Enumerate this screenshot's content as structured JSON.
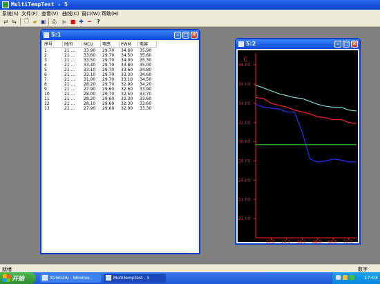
{
  "app": {
    "title": "MultiTempTest - 5"
  },
  "menu": [
    "系统(S)",
    "文件(F)",
    "查看(V)",
    "曲线(C)",
    "窗口(W)",
    "帮助(H)"
  ],
  "toolbar": {
    "icons": [
      "connect-icon",
      "disconnect-icon",
      "new-file-icon",
      "open-folder-icon",
      "save-icon",
      "print-icon",
      "play-icon",
      "stop-icon",
      "add-icon",
      "remove-icon",
      "help-icon"
    ]
  },
  "table_window": {
    "title": "5:1",
    "columns": [
      "序号",
      "时间",
      "MCU",
      "电感",
      "PWM",
      "电容"
    ],
    "rows": [
      [
        "1",
        "21 ...",
        "33.90",
        "29.70",
        "34.60",
        "35.90"
      ],
      [
        "2",
        "21 ...",
        "33.60",
        "29.70",
        "34.50",
        "35.60"
      ],
      [
        "3",
        "21 ...",
        "33.50",
        "29.70",
        "34.00",
        "35.30"
      ],
      [
        "4",
        "21 ...",
        "33.40",
        "29.70",
        "33.80",
        "35.00"
      ],
      [
        "5",
        "21 ...",
        "33.10",
        "29.70",
        "33.60",
        "34.80"
      ],
      [
        "6",
        "21 ...",
        "33.10",
        "29.70",
        "33.30",
        "34.60"
      ],
      [
        "7",
        "21 ...",
        "31.00",
        "29.70",
        "33.10",
        "34.50"
      ],
      [
        "8",
        "21 ...",
        "28.20",
        "29.70",
        "32.90",
        "34.20"
      ],
      [
        "9",
        "21 ...",
        "27.90",
        "29.60",
        "32.60",
        "33.90"
      ],
      [
        "10",
        "21 ...",
        "28.00",
        "29.70",
        "32.50",
        "33.70"
      ],
      [
        "11",
        "21 ...",
        "28.20",
        "29.60",
        "32.30",
        "33.60"
      ],
      [
        "12",
        "21 ...",
        "28.10",
        "29.60",
        "32.30",
        "33.60"
      ],
      [
        "13",
        "21 ...",
        "27.90",
        "29.60",
        "32.00",
        "33.30"
      ]
    ]
  },
  "chart_window": {
    "title": "5:2"
  },
  "chart_data": {
    "type": "line",
    "ylabel": "C",
    "ylim": [
      20.0,
      38.8
    ],
    "yticks": [
      "38.00",
      "36.00",
      "34.00",
      "32.00",
      "30.00",
      "28.00",
      "26.00",
      "24.00",
      "22.00"
    ],
    "xticks": [
      "12.0",
      "24.0",
      "36.0",
      "48.0",
      "60.0",
      "72.0"
    ],
    "xlim": [
      0,
      78
    ],
    "colors": {
      "background": "#000000",
      "axis": "#ff2020",
      "grid": "#800000"
    },
    "series": [
      {
        "color": "#7fd8d8",
        "x": [
          0,
          6,
          12,
          18,
          24,
          30,
          36,
          42,
          48,
          54,
          60,
          66,
          72,
          78
        ],
        "values": [
          35.9,
          35.6,
          35.3,
          35.0,
          34.8,
          34.6,
          34.5,
          34.2,
          33.9,
          33.7,
          33.6,
          33.6,
          33.3,
          33.2
        ]
      },
      {
        "color": "#ff2020",
        "x": [
          0,
          6,
          12,
          18,
          24,
          30,
          36,
          42,
          48,
          54,
          60,
          66,
          72,
          78
        ],
        "values": [
          34.6,
          34.5,
          34.0,
          33.8,
          33.6,
          33.3,
          33.1,
          32.9,
          32.6,
          32.5,
          32.3,
          32.3,
          32.0,
          31.9
        ]
      },
      {
        "color": "#2030ff",
        "x": [
          0,
          6,
          12,
          18,
          24,
          30,
          36,
          42,
          48,
          54,
          60,
          66,
          72,
          78
        ],
        "values": [
          33.9,
          33.6,
          33.5,
          33.4,
          33.1,
          33.1,
          31.0,
          28.2,
          27.9,
          28.0,
          28.2,
          28.1,
          27.9,
          27.9
        ]
      },
      {
        "color": "#30d030",
        "x": [
          0,
          78
        ],
        "values": [
          29.7,
          29.7
        ]
      }
    ]
  },
  "status": {
    "left": "就绪",
    "right": "数字"
  },
  "taskbar": {
    "start_label": "开始",
    "tasks": [
      "XUNGZAI - Window...",
      "MultiTempTest - 5"
    ],
    "clock": "17:03"
  }
}
